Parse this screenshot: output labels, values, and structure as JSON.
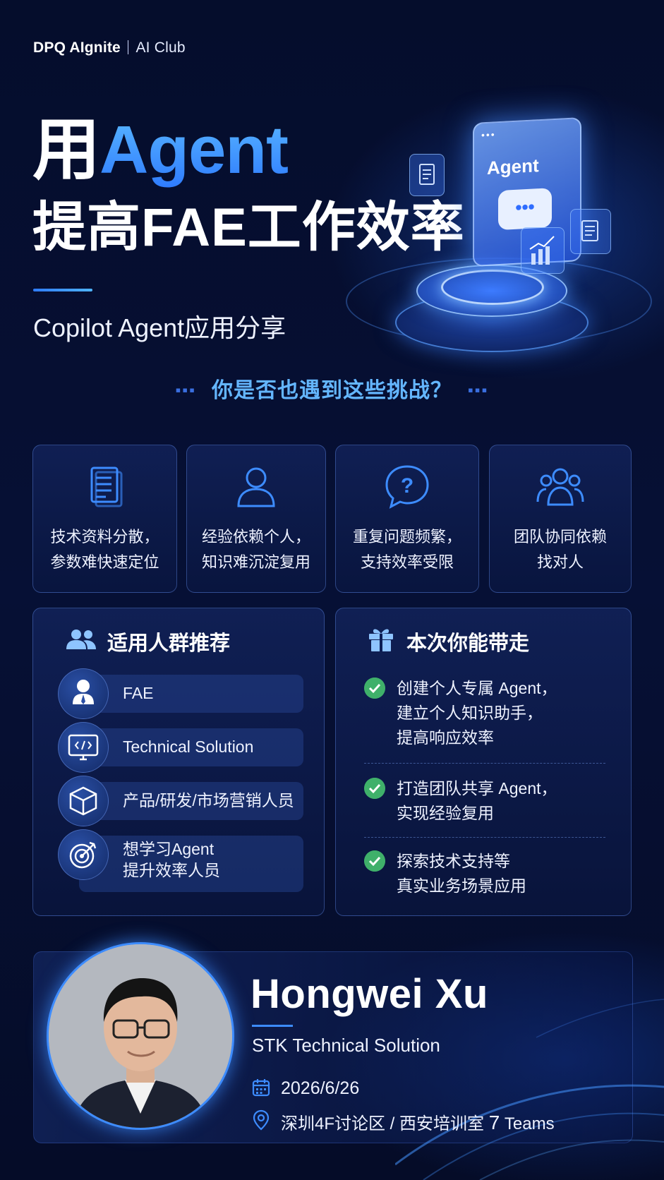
{
  "brand": {
    "name": "DPQ AIgnite",
    "club": "AI Club"
  },
  "hero": {
    "title_prefix": "用",
    "title_accent": "Agent",
    "title_line2": "提高FAE工作效率",
    "subtitle": "Copilot Agent应用分享",
    "panel_label": "Agent",
    "panel_dots": "•••",
    "bubble_dots": "•••"
  },
  "challenges": {
    "heading": "你是否也遇到这些挑战？",
    "items": [
      {
        "icon": "document-icon",
        "line1": "技术资料分散，",
        "line2": "参数难快速定位"
      },
      {
        "icon": "person-icon",
        "line1": "经验依赖个人，",
        "line2": "知识难沉淀复用"
      },
      {
        "icon": "question-bubble-icon",
        "line1": "重复问题频繁，",
        "line2": "支持效率受限"
      },
      {
        "icon": "team-icon",
        "line1": "团队协同依赖",
        "line2": "找对人"
      }
    ]
  },
  "audience": {
    "title": "适用人群推荐",
    "items": [
      {
        "icon": "user-tie-icon",
        "line1": "FAE",
        "line2": ""
      },
      {
        "icon": "code-monitor-icon",
        "line1": "Technical Solution",
        "line2": ""
      },
      {
        "icon": "box-icon",
        "line1": "产品/研发/市场营销人员",
        "line2": ""
      },
      {
        "icon": "target-icon",
        "line1": "想学习Agent",
        "line2": "提升效率人员"
      }
    ]
  },
  "takeaways": {
    "title": "本次你能带走",
    "items": [
      {
        "lines": [
          "创建个人专属 Agent，",
          "建立个人知识助手，",
          "提高响应效率"
        ]
      },
      {
        "lines": [
          "打造团队共享 Agent，",
          "实现经验复用"
        ]
      },
      {
        "lines": [
          "探索技术支持等",
          "真实业务场景应用"
        ]
      }
    ]
  },
  "speaker": {
    "name": "Hongwei Xu",
    "team": "STK Technical Solution",
    "date": "2026/6/26",
    "location_main": "深圳4F讨论区 / 西安培训室 ",
    "location_big": "7",
    "location_tail": " Teams"
  },
  "colors": {
    "accent": "#3aa0ff",
    "check": "#3fb06a",
    "background": "#050d2a"
  }
}
